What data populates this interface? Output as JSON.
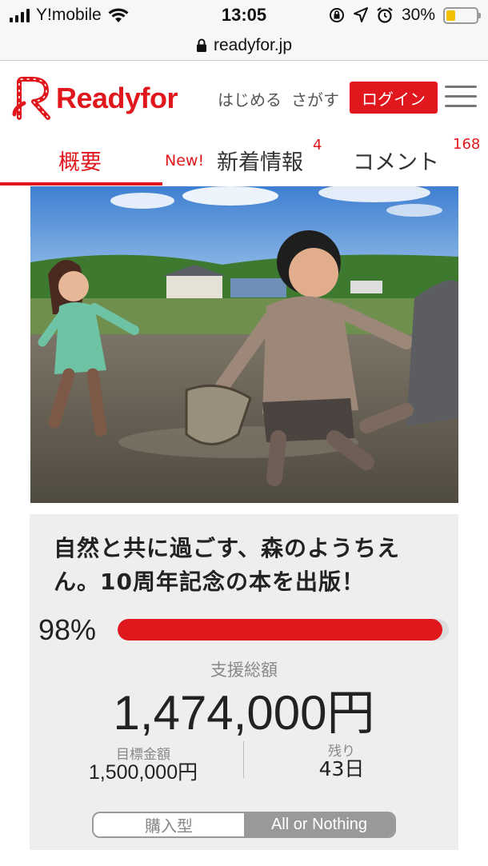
{
  "status_bar": {
    "carrier": "Y!mobile",
    "time": "13:05",
    "battery": "30%",
    "battery_level": 0.3
  },
  "browser": {
    "url": "readyfor.jp"
  },
  "header": {
    "logo": "Readyfor",
    "nav": [
      "はじめる",
      "さがす"
    ],
    "login": "ログイン"
  },
  "tabs": {
    "overview": "概要",
    "new_label": "New!",
    "news": "新着情報",
    "news_count": "4",
    "comments": "コメント",
    "comments_count": "168"
  },
  "project": {
    "title": "自然と共に過ごす、森のようちえん。10周年記念の本を出版！",
    "percent": "98%",
    "progress": 0.98,
    "total_label": "支援総額",
    "total": "1,474,000円",
    "goal_label": "目標金額",
    "goal": "1,500,000円",
    "remaining_label": "残り",
    "remaining": "43日",
    "type_left": "購入型",
    "type_right": "All or Nothing"
  },
  "colors": {
    "brand": "#e0181e",
    "card_bg": "#eeeeee"
  },
  "icons": [
    "signal-icon",
    "wifi-icon",
    "lock-icon",
    "orientation-lock-icon",
    "location-icon",
    "alarm-icon",
    "battery-icon",
    "menu-icon"
  ]
}
